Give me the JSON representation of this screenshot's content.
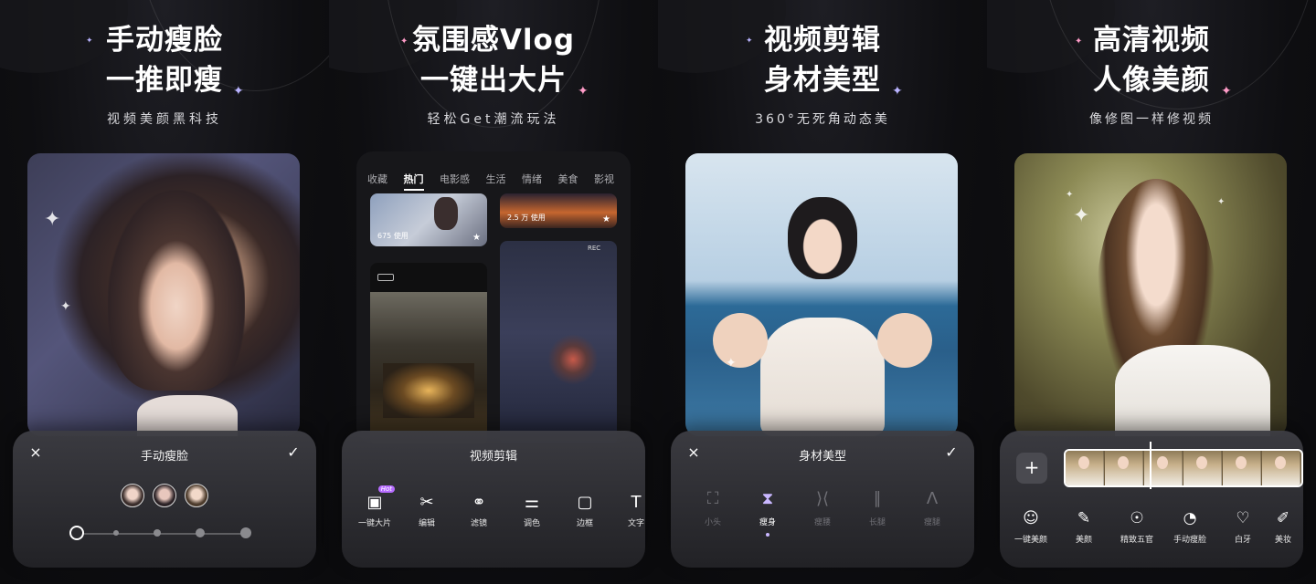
{
  "panels": [
    {
      "headline_1": "手动瘦脸",
      "headline_2": "一推即瘦",
      "subline": "视频美颜黑科技",
      "sheet_title": "手动瘦脸",
      "close_icon": "×",
      "confirm_icon": "✓"
    },
    {
      "headline_1": "氛围感Vlog",
      "headline_2": "一键出大片",
      "subline": "轻松Get潮流玩法",
      "categories": [
        "收藏",
        "热门",
        "电影感",
        "生活",
        "情绪",
        "美食",
        "影视"
      ],
      "active_category": "热门",
      "tiles": [
        {
          "usage": "675 使用"
        },
        {
          "usage": "2.5 万 使用"
        }
      ],
      "sheet_title": "视频剪辑",
      "hot_badge": "Hot",
      "tools": [
        "一键大片",
        "编辑",
        "滤镜",
        "调色",
        "边框",
        "文字"
      ]
    },
    {
      "headline_1": "视频剪辑",
      "headline_2": "身材美型",
      "subline": "360°无死角动态美",
      "sheet_title": "身材美型",
      "close_icon": "×",
      "confirm_icon": "✓",
      "options": [
        "小头",
        "瘦身",
        "瘦腰",
        "长腿",
        "瘦腿"
      ],
      "active_option": "瘦身"
    },
    {
      "headline_1": "高清视频",
      "headline_2": "人像美颜",
      "subline": "像修图一样修视频",
      "add_icon": "+",
      "options": [
        "一键美颜",
        "美颜",
        "精致五官",
        "手动瘦脸",
        "白牙",
        "美妆"
      ]
    }
  ],
  "colors": {
    "background": "#0d0d0f",
    "sheet": "#2a2a2e",
    "accent_purple": "#c9b7ff",
    "hot_badge": "#b66cff"
  }
}
